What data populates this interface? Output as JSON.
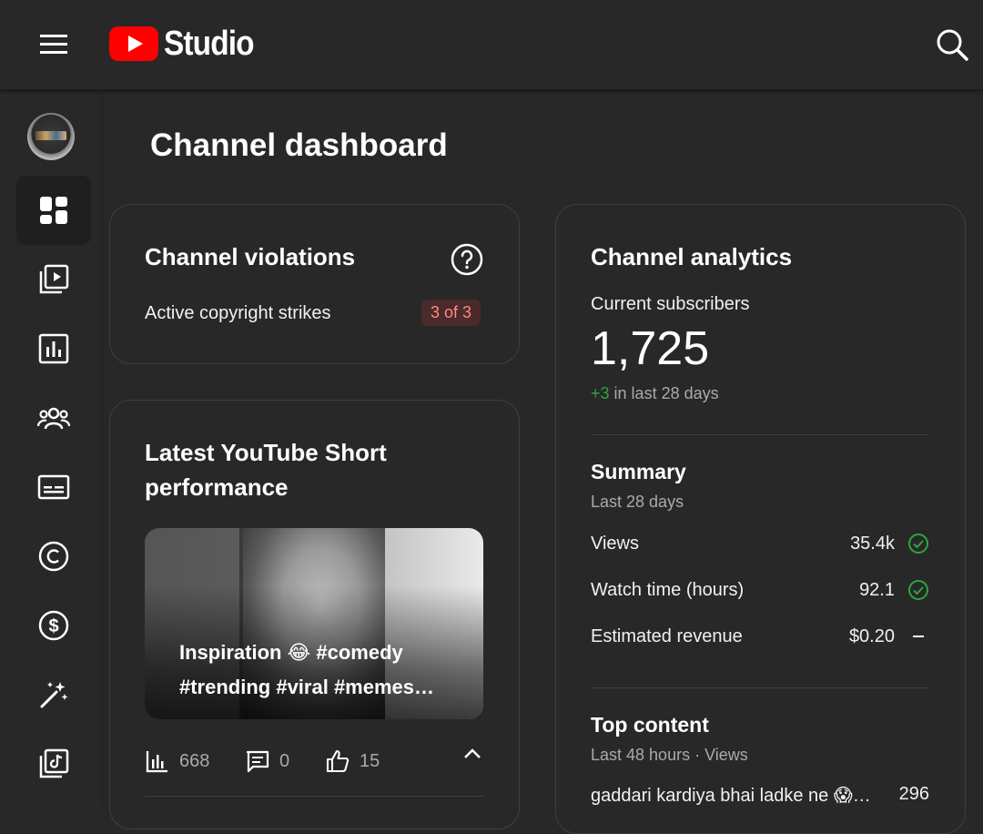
{
  "header": {
    "app_name": "Studio",
    "menu_icon": "hamburger-menu-icon",
    "search_icon": "search-icon",
    "logo_color": "#ff0000"
  },
  "sidebar": {
    "items": [
      {
        "icon": "dashboard-icon",
        "active": true
      },
      {
        "icon": "content-icon",
        "active": false
      },
      {
        "icon": "analytics-icon",
        "active": false
      },
      {
        "icon": "community-icon",
        "active": false
      },
      {
        "icon": "subtitles-icon",
        "active": false
      },
      {
        "icon": "copyright-icon",
        "active": false
      },
      {
        "icon": "earn-icon",
        "active": false
      },
      {
        "icon": "customization-icon",
        "active": false
      },
      {
        "icon": "audio-library-icon",
        "active": false
      }
    ]
  },
  "page": {
    "title": "Channel dashboard"
  },
  "violations": {
    "title": "Channel violations",
    "strikes_label": "Active copyright strikes",
    "strikes_value": "3 of 3"
  },
  "latest_short": {
    "title": "Latest YouTube Short performance",
    "caption": "Inspiration 😂 #comedy #trending #viral #memes…",
    "views": "668",
    "comments": "0",
    "likes": "15"
  },
  "analytics": {
    "title": "Channel analytics",
    "subscribers_label": "Current subscribers",
    "subscribers_count": "1,725",
    "subscribers_change": "+3",
    "subscribers_change_period": "in last 28 days",
    "summary": {
      "title": "Summary",
      "period": "Last 28 days",
      "metrics": [
        {
          "label": "Views",
          "value": "35.4k",
          "status": "check-circle-icon"
        },
        {
          "label": "Watch time (hours)",
          "value": "92.1",
          "status": "check-circle-icon"
        },
        {
          "label": "Estimated revenue",
          "value": "$0.20",
          "status": "dash-icon"
        }
      ]
    },
    "top_content": {
      "title": "Top content",
      "period": "Last 48 hours · Views",
      "items": [
        {
          "title": "gaddari kardiya bhai ladke ne 😱…",
          "views": "296"
        }
      ]
    }
  },
  "colors": {
    "positive": "#2ba640",
    "strike_badge_bg": "#4a2a2a",
    "strike_badge_text": "#ff8a80"
  }
}
